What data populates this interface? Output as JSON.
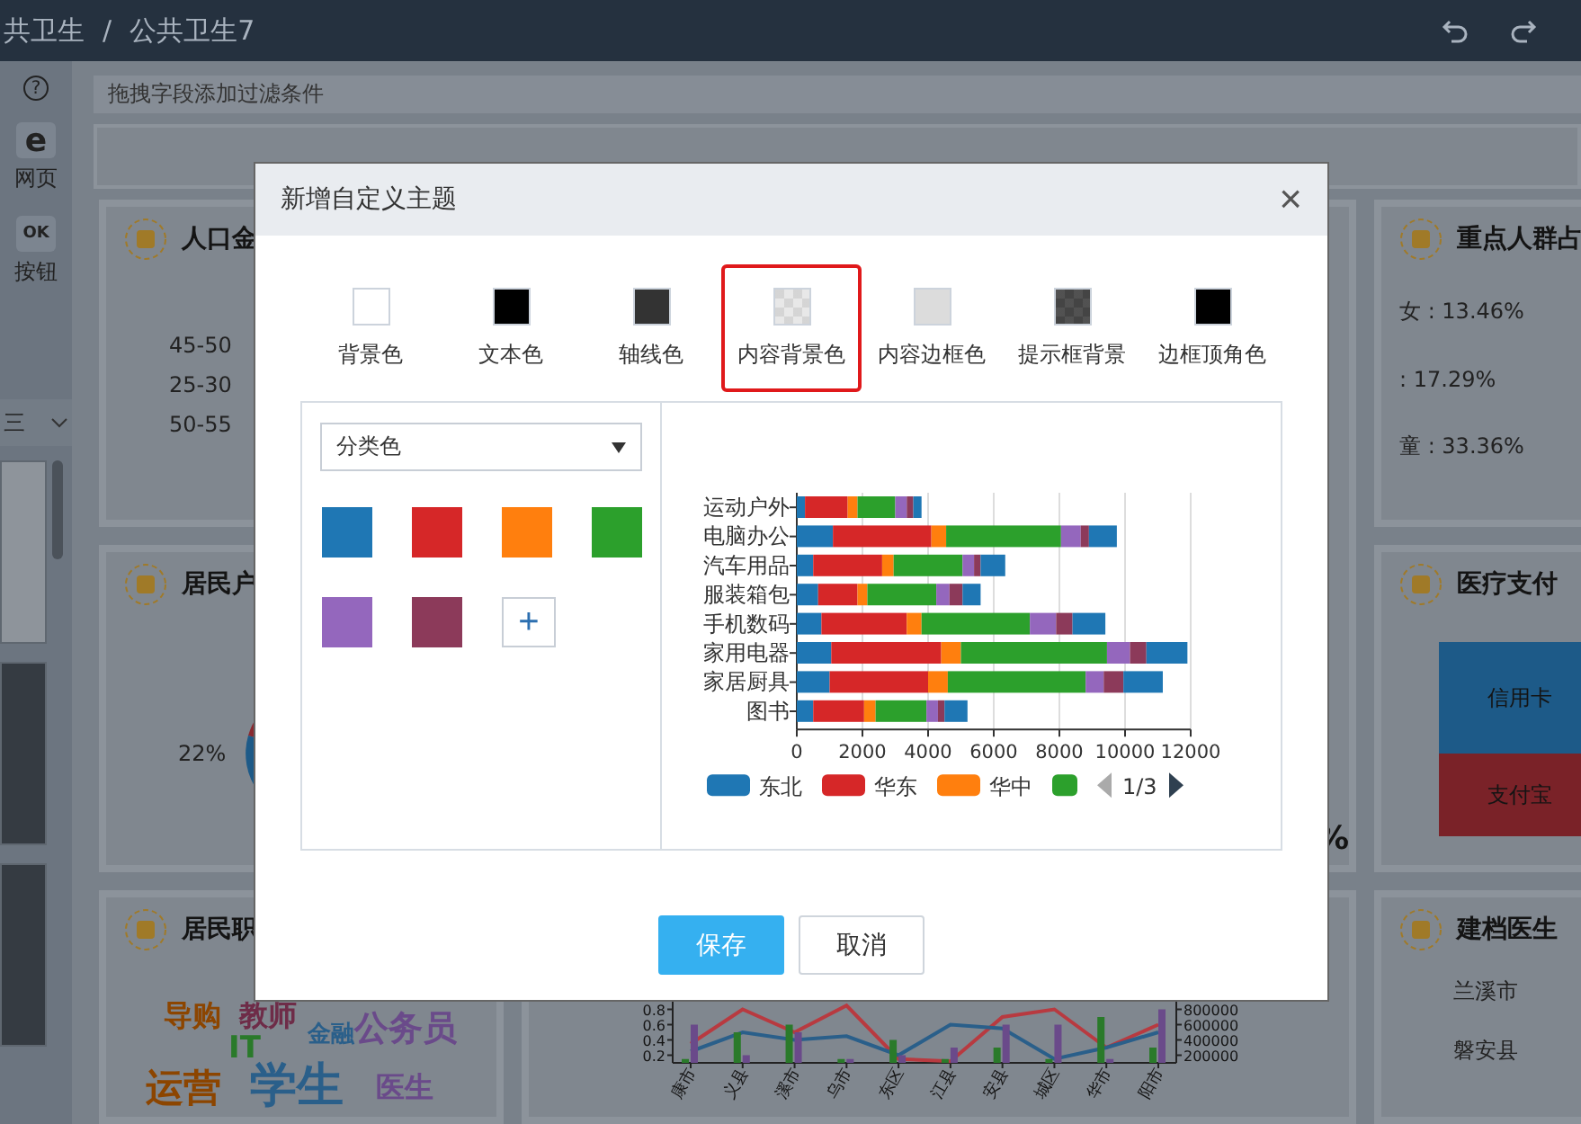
{
  "top_bar": {
    "breadcrumb": [
      "共卫生",
      "公共卫生7"
    ],
    "separator": "/"
  },
  "sidebar": {
    "help": "?",
    "tools": [
      {
        "glyph": "e",
        "label": "网页"
      },
      {
        "glyph": "OK",
        "label": "按钮"
      }
    ],
    "panel_menu": "三"
  },
  "filter_bar": {
    "hint": "拖拽字段添加过滤条件"
  },
  "left_cards": [
    {
      "kind": "labels",
      "title": "人口金",
      "labels": [
        "45-50",
        "25-30",
        "50-55"
      ]
    },
    {
      "kind": "pie",
      "title": "居民户",
      "labels": [
        "22%"
      ]
    },
    {
      "kind": "cloud",
      "title": "居民职",
      "words": [
        {
          "text": "导购",
          "color": "#8c4500"
        },
        {
          "text": "教师",
          "color": "#6e2c48"
        },
        {
          "text": "金融",
          "color": "#2a5f8a"
        },
        {
          "text": "公务员",
          "color": "#6a4a8a"
        },
        {
          "text": "IT",
          "color": "#2a7a2a"
        },
        {
          "text": "运营",
          "color": "#8c4500"
        },
        {
          "text": "学生",
          "color": "#2a5f8a"
        },
        {
          "text": "医生",
          "color": "#6a4a8a"
        }
      ]
    }
  ],
  "middle": {
    "big_value": "%",
    "mini_chart": {
      "chart_data": {
        "type": "line",
        "categories": [
          "康市",
          "义县",
          "溪市",
          "乌市",
          "东区",
          "江县",
          "安县",
          "城区",
          "华市",
          "阳市"
        ],
        "ylim": [
          0.1,
          0.9
        ],
        "yticks": [
          0.2,
          0.4,
          0.6,
          0.8
        ],
        "series": [
          {
            "color": "#b83a40",
            "values": [
              0.35,
              0.8,
              0.5,
              0.85,
              0.15,
              0.12,
              0.7,
              0.8,
              0.3,
              0.6
            ]
          },
          {
            "color": "#2a5f8a",
            "values": [
              0.25,
              0.5,
              0.4,
              0.45,
              0.2,
              0.6,
              0.55,
              0.15,
              0.3,
              0.5
            ]
          }
        ]
      }
    },
    "mini_bars": {
      "chart_data": {
        "type": "bar",
        "ylim": [
          100000,
          900000
        ],
        "yticks": [
          200000,
          400000,
          600000,
          800000
        ],
        "series": [
          {
            "color": "#2a7a2a",
            "values": [
              150000,
              500000,
              600000,
              150000,
              400000,
              150000,
              300000,
              150000,
              700000,
              300000
            ]
          },
          {
            "color": "#6a4a8a",
            "values": [
              600000,
              200000,
              500000,
              150000,
              200000,
              300000,
              600000,
              600000,
              150000,
              800000
            ]
          }
        ]
      }
    }
  },
  "right_cards": [
    {
      "kind": "pie",
      "title": "重点人群占",
      "labels": [
        "女 : 13.46%",
        ": 17.29%",
        "童 : 33.36%"
      ]
    },
    {
      "kind": "treemap",
      "title": "医疗支付",
      "blocks": [
        {
          "label": "信用卡",
          "color": "#1d5a88"
        },
        {
          "label": "支付宝",
          "color": "#7a2228"
        }
      ]
    },
    {
      "kind": "bars",
      "title": "建档医生",
      "labels": [
        "兰溪市",
        "磐安县"
      ]
    }
  ],
  "dialog": {
    "title": "新增自定义主题",
    "close": "×",
    "swatches": [
      {
        "label": "背景色",
        "kind": "solid",
        "color": "#ffffff",
        "selected": false
      },
      {
        "label": "文本色",
        "kind": "solid",
        "color": "#000000",
        "selected": false
      },
      {
        "label": "轴线色",
        "kind": "solid",
        "color": "#333333",
        "selected": false
      },
      {
        "label": "内容背景色",
        "kind": "checker",
        "color": "#e8e8e8",
        "selected": true
      },
      {
        "label": "内容边框色",
        "kind": "solid",
        "color": "#dcdcdc",
        "selected": false
      },
      {
        "label": "提示框背景",
        "kind": "checker",
        "color": "#444444",
        "selected": false
      },
      {
        "label": "边框顶角色",
        "kind": "solid",
        "color": "#000000",
        "selected": false
      }
    ],
    "palette_select": {
      "value": "分类色"
    },
    "palette": [
      {
        "color": "#1f77b4"
      },
      {
        "color": "#d62728"
      },
      {
        "color": "#ff7f0e"
      },
      {
        "color": "#2ca02c"
      },
      {
        "color": "#9467bd"
      },
      {
        "color": "#8c3a5a"
      }
    ],
    "add_color": "+",
    "preview": {
      "legend_page": "1/3",
      "chart_data": {
        "type": "bar",
        "orientation": "horizontal",
        "stacked": true,
        "grid": true,
        "legend": true,
        "categories": [
          "运动户外",
          "电脑办公",
          "汽车用品",
          "服装箱包",
          "手机数码",
          "家用电器",
          "家居厨具",
          "图书"
        ],
        "xlim": [
          0,
          12000
        ],
        "xticks": [
          0,
          2000,
          4000,
          6000,
          8000,
          10000,
          12000
        ],
        "series": [
          {
            "name": "东北",
            "color": "#1f77b4",
            "values": [
              250,
              1100,
              500,
              650,
              750,
              1050,
              1000,
              500
            ]
          },
          {
            "name": "华东",
            "color": "#d62728",
            "values": [
              1300,
              3000,
              2100,
              1200,
              2600,
              3350,
              3000,
              1550
            ]
          },
          {
            "name": "华中",
            "color": "#ff7f0e",
            "values": [
              300,
              450,
              350,
              300,
              450,
              600,
              600,
              350
            ]
          },
          {
            "color": "#2ca02c",
            "values": [
              1150,
              3500,
              2100,
              2100,
              3300,
              4450,
              4200,
              1550
            ]
          },
          {
            "color": "#9467bd",
            "values": [
              350,
              600,
              350,
              400,
              800,
              700,
              550,
              350
            ]
          },
          {
            "color": "#8c3a5a",
            "values": [
              200,
              250,
              200,
              400,
              500,
              500,
              600,
              200
            ]
          },
          {
            "color": "#1f77b4",
            "values": [
              250,
              850,
              750,
              550,
              1000,
              1250,
              1200,
              700
            ]
          }
        ]
      }
    },
    "buttons": [
      {
        "label": "保存",
        "kind": "primary"
      },
      {
        "label": "取消",
        "kind": "default"
      }
    ]
  }
}
